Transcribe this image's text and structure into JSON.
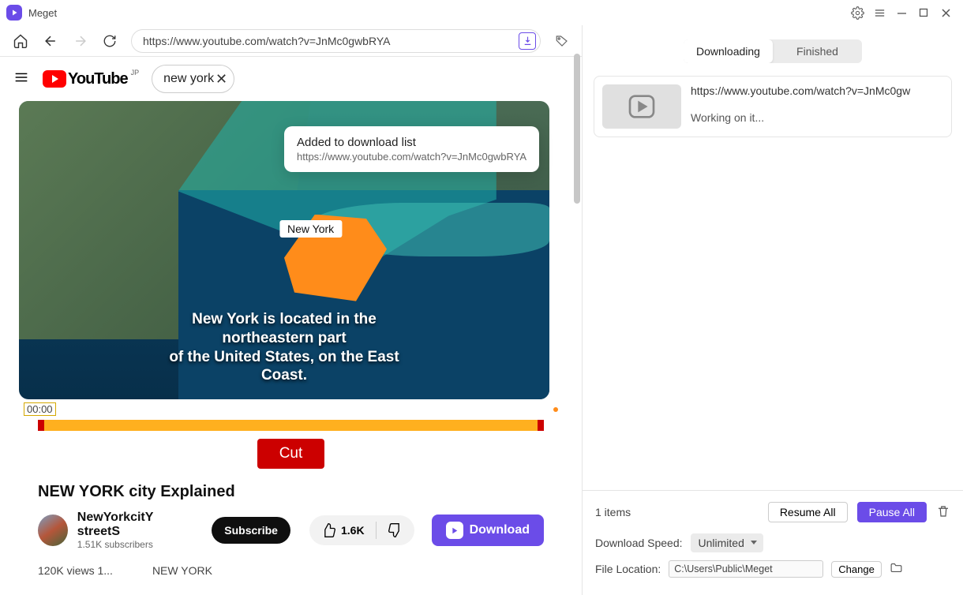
{
  "app": {
    "title": "Meget"
  },
  "browser": {
    "url": "https://www.youtube.com/watch?v=JnMc0gwbRYA"
  },
  "youtube": {
    "brand": "YouTube",
    "region": "JP",
    "search_value": "new york",
    "map_label": "New York",
    "caption_line1": "New York is located in the northeastern part",
    "caption_line2": "of the United States, on the East Coast.",
    "time_tag": "00:00",
    "cut_label": "Cut",
    "video_title": "NEW YORK city Explained",
    "channel_name": "NewYorkcitY streetS",
    "channel_subs": "1.51K subscribers",
    "subscribe_label": "Subscribe",
    "likes": "1.6K",
    "download_label": "Download",
    "views_line": "120K views 1...",
    "tag_line": "NEW YORK"
  },
  "toast": {
    "title": "Added to download list",
    "url": "https://www.youtube.com/watch?v=JnMc0gwbRYA"
  },
  "right": {
    "tab_downloading": "Downloading",
    "tab_finished": "Finished",
    "item_url": "https://www.youtube.com/watch?v=JnMc0gw",
    "item_status": "Working on it...",
    "items_count": "1 items",
    "resume_all": "Resume All",
    "pause_all": "Pause All",
    "speed_label": "Download Speed:",
    "speed_value": "Unlimited",
    "location_label": "File Location:",
    "location_value": "C:\\Users\\Public\\Meget",
    "change_label": "Change"
  }
}
